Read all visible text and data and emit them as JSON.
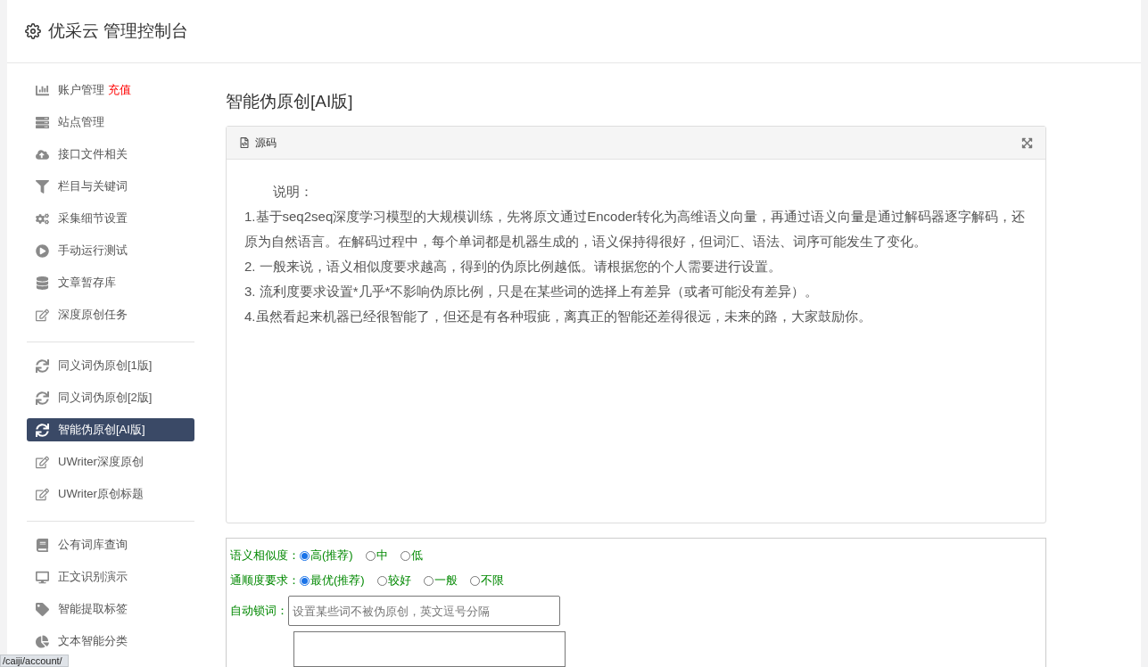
{
  "header": {
    "title": "优采云 管理控制台"
  },
  "sidebar": {
    "groups": [
      {
        "items": [
          {
            "label": "账户管理",
            "badge": "充值",
            "selected": false
          },
          {
            "label": "站点管理",
            "selected": false
          },
          {
            "label": "接口文件相关",
            "selected": false
          },
          {
            "label": "栏目与关键词",
            "selected": false
          },
          {
            "label": "采集细节设置",
            "selected": false
          },
          {
            "label": "手动运行测试",
            "selected": false
          },
          {
            "label": "文章暂存库",
            "selected": false
          },
          {
            "label": "深度原创任务",
            "selected": false
          }
        ]
      },
      {
        "items": [
          {
            "label": "同义词伪原创[1版]",
            "selected": false
          },
          {
            "label": "同义词伪原创[2版]",
            "selected": false
          },
          {
            "label": "智能伪原创[AI版]",
            "selected": true
          },
          {
            "label": "UWriter深度原创",
            "selected": false
          },
          {
            "label": "UWriter原创标题",
            "selected": false
          }
        ]
      },
      {
        "items": [
          {
            "label": "公有词库查询",
            "selected": false
          },
          {
            "label": "正文识别演示",
            "selected": false
          },
          {
            "label": "智能提取标签",
            "selected": false
          },
          {
            "label": "文本智能分类",
            "selected": false
          }
        ]
      }
    ]
  },
  "main": {
    "title": "智能伪原创[AI版]",
    "editor": {
      "tab": "源码",
      "note_title": "说明：",
      "paragraphs": [
        "1.基于seq2seq深度学习模型的大规模训练，先将原文通过Encoder转化为高维语义向量，再通过语义向量是通过解码器逐字解码，还原为自然语言。在解码过程中，每个单词都是机器生成的，语义保持得很好，但词汇、语法、词序可能发生了变化。",
        "2. 一般来说，语义相似度要求越高，得到的伪原比例越低。请根据您的个人需要进行设置。",
        "3. 流利度要求设置*几乎*不影响伪原比例，只是在某些词的选择上有差异（或者可能没有差异）。",
        "4.虽然看起来机器已经很智能了，但还是有各种瑕疵，离真正的智能还差得很远，未来的路，大家鼓励你。"
      ]
    },
    "form": [
      {
        "kind": "radio",
        "label": "语义相似度：",
        "options": [
          {
            "label": "高(推荐)",
            "selected": true
          },
          {
            "label": "中",
            "selected": false
          },
          {
            "label": "低",
            "selected": false
          }
        ]
      },
      {
        "kind": "radio",
        "label": "通顺度要求：",
        "options": [
          {
            "label": "最优(推荐)",
            "selected": true
          },
          {
            "label": "较好",
            "selected": false
          },
          {
            "label": "一般",
            "selected": false
          },
          {
            "label": "不限",
            "selected": false
          }
        ]
      },
      {
        "kind": "input",
        "label": "自动锁词：",
        "placeholder": "设置某些词不被伪原创，英文逗号分隔"
      },
      {
        "kind": "textarea"
      }
    ]
  },
  "status_bar": {
    "url": "/caiji/account/"
  }
}
